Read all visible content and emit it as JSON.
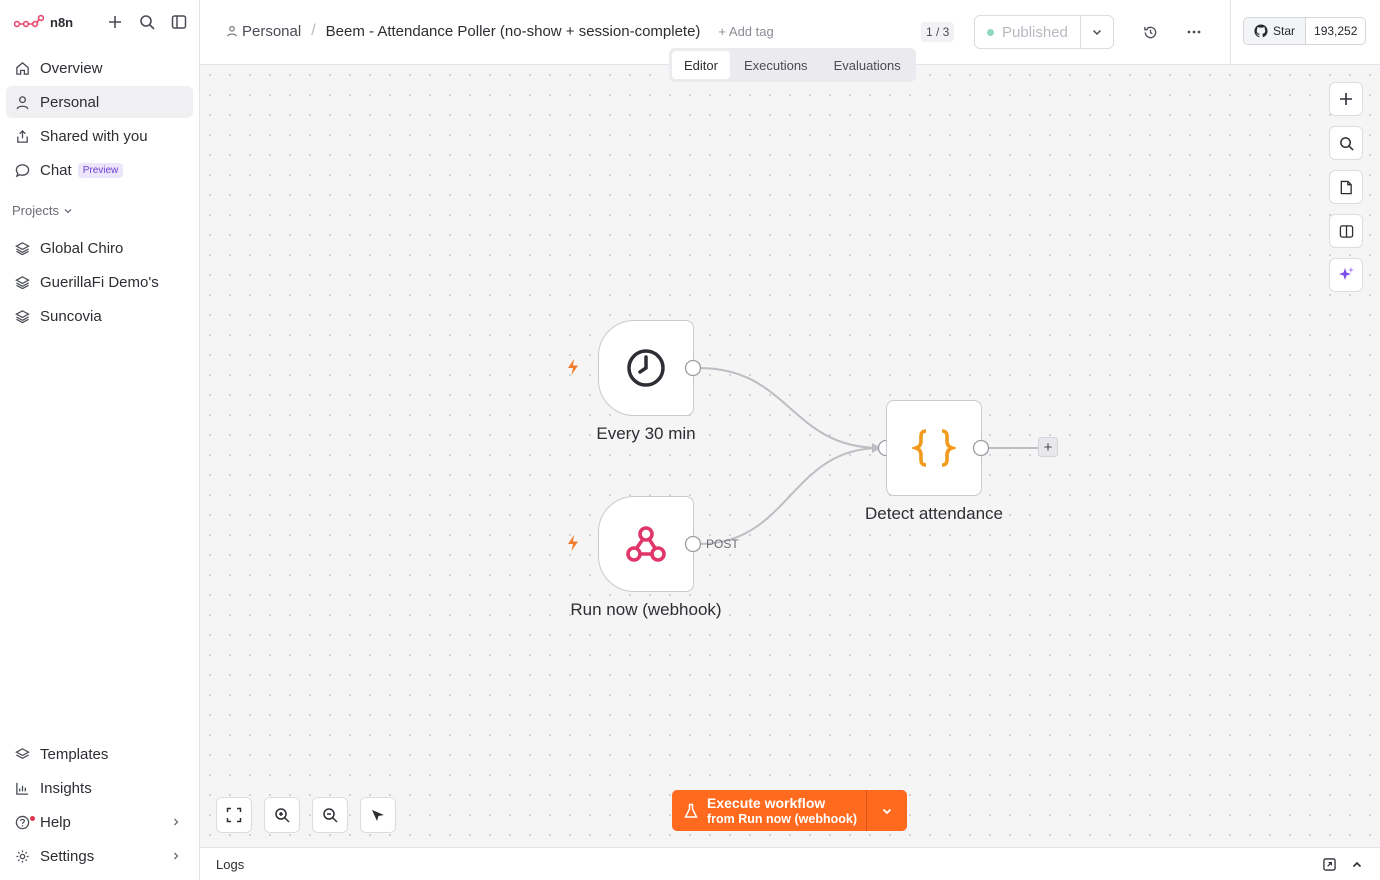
{
  "app": {
    "name": "n8n"
  },
  "sidebar": {
    "nav": [
      {
        "label": "Overview",
        "icon": "home-icon"
      },
      {
        "label": "Personal",
        "icon": "user-icon"
      },
      {
        "label": "Shared with you",
        "icon": "share-icon"
      },
      {
        "label": "Chat",
        "icon": "chat-icon",
        "badge": "Preview"
      }
    ],
    "projects_label": "Projects",
    "projects": [
      "Global Chiro",
      "GuerillaFi Demo's",
      "Suncovia"
    ],
    "bottom": [
      {
        "label": "Templates",
        "icon": "templates-icon"
      },
      {
        "label": "Insights",
        "icon": "insights-icon"
      },
      {
        "label": "Help",
        "icon": "help-icon"
      },
      {
        "label": "Settings",
        "icon": "settings-icon"
      }
    ]
  },
  "header": {
    "project": "Personal",
    "workflow_title": "Beem - Attendance Poller (no-show + session-complete)",
    "add_tag": "+ Add tag",
    "page_count": "1 / 3",
    "publish_label": "Published",
    "github": {
      "star_label": "Star",
      "star_count": "193,252"
    }
  },
  "tabs": [
    {
      "label": "Editor",
      "active": true
    },
    {
      "label": "Executions",
      "active": false
    },
    {
      "label": "Evaluations",
      "active": false
    }
  ],
  "nodes": {
    "schedule": {
      "label": "Every 30 min",
      "icon": "clock-icon"
    },
    "webhook": {
      "label": "Run now (webhook)",
      "icon": "webhook-icon",
      "method": "POST"
    },
    "code": {
      "label": "Detect attendance",
      "icon": "code-braces-icon"
    }
  },
  "execute": {
    "title": "Execute workflow",
    "subtitle": "from Run now (webhook)"
  },
  "logs": {
    "label": "Logs"
  },
  "colors": {
    "accent": "#ff6a1f",
    "trigger_bolt": "#f07d2b",
    "webhook_icon": "#e0366a",
    "code_icon": "#f29a1d",
    "published_dot": "#8dd8c4"
  }
}
